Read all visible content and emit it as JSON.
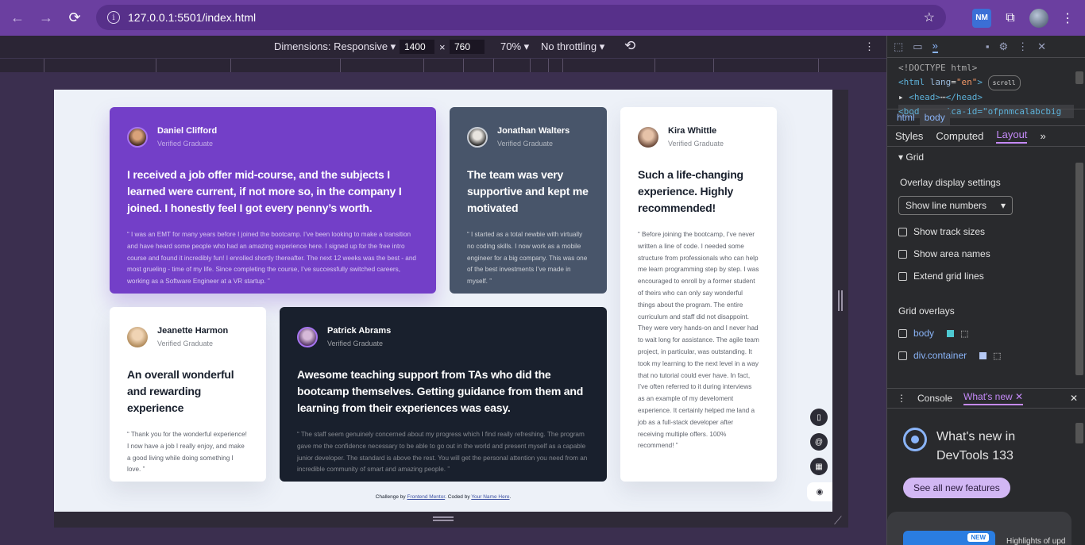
{
  "browser": {
    "url": "127.0.0.1:5501/index.html",
    "back_icon": "back-arrow-icon",
    "forward_icon": "forward-arrow-icon",
    "reload_icon": "reload-icon",
    "ext_label": "NM"
  },
  "device_toolbar": {
    "dimensions": "Dimensions: Responsive ▾",
    "width": "1400",
    "times": "×",
    "height": "760",
    "zoom": "70% ▾",
    "throttle": "No throttling ▾"
  },
  "testimonials": [
    {
      "name": "Daniel Clifford",
      "tag": "Verified Graduate",
      "headline": "I received a job offer mid-course, and the subjects I learned were current, if not more so, in the company I joined. I honestly feel I got every penny’s worth.",
      "quote": "“ I was an EMT for many years before I joined the bootcamp. I’ve been looking to make a transition and have heard some people who had an amazing experience here. I signed up for the free intro course and found it incredibly fun! I enrolled shortly thereafter. The next 12 weeks was the best - and most grueling - time of my life. Since completing the course, I’ve successfully switched careers, working as a Software Engineer at a VR startup. ”"
    },
    {
      "name": "Jonathan Walters",
      "tag": "Verified Graduate",
      "headline": "The team was very supportive and kept me motivated",
      "quote": "“ I started as a total newbie with virtually no coding skills. I now work as a mobile engineer for a big company. This was one of the best investments I’ve made in myself. ”"
    },
    {
      "name": "Kira Whittle",
      "tag": "Verified Graduate",
      "headline": "Such a life-changing experience. Highly recommended!",
      "quote": "“ Before joining the bootcamp, I’ve never written a line of code. I needed some structure from professionals who can help me learn programming step by step. I was encouraged to enroll by a former student of theirs who can only say wonderful things about the program. The entire curriculum and staff did not disappoint. They were very hands-on and I never had to wait long for assistance. The agile team project, in particular, was outstanding. It took my learning to the next level in a way that no tutorial could ever have. In fact, I’ve often referred to it during interviews as an example of my develoment experience. It certainly helped me land a job as a full-stack developer after receiving multiple offers. 100% recommend! ”"
    },
    {
      "name": "Jeanette Harmon",
      "tag": "Verified Graduate",
      "headline": "An overall wonderful and rewarding experience",
      "quote": "“ Thank you for the wonderful experience! I now have a job I really enjoy, and make a good living while doing something I love. ”"
    },
    {
      "name": "Patrick Abrams",
      "tag": "Verified Graduate",
      "headline": "Awesome teaching support from TAs who did the bootcamp themselves. Getting guidance from them and learning from their experiences was easy.",
      "quote": "“ The staff seem genuinely concerned about my progress which I find really refreshing. The program gave me the confidence necessary to be able to go out in the world and present myself as a capable junior developer. The standard is above the rest. You will get the personal attention you need from an incredible community of smart and amazing people. ”"
    }
  ],
  "attribution": {
    "prefix": "Challenge by ",
    "fm": "Frontend Mentor",
    "mid": ". Coded by ",
    "name": "Your Name Here",
    "end": "."
  },
  "devtools": {
    "dom_doctype": "<!DOCTYPE html>",
    "dom_html_tag": "<html",
    "dom_html_attr": "lang",
    "dom_html_val": "\"en\"",
    "dom_html_close": ">",
    "dom_scroll": "scroll",
    "dom_head": "<head>",
    "dom_head_close": "</head>",
    "dom_ellipsis": "⋯",
    "dom_body": "<body monica-id=\"ofpnmcalabcbig",
    "crumb_html": "html",
    "crumb_body": "body",
    "tab_styles": "Styles",
    "tab_computed": "Computed",
    "tab_layout": "Layout",
    "grid_title": "Grid",
    "overlay_heading": "Overlay display settings",
    "select_value": "Show line numbers",
    "check_track": "Show track sizes",
    "check_area": "Show area names",
    "check_extend": "Extend grid lines",
    "overlays_heading": "Grid overlays",
    "overlay_body": "body",
    "overlay_container": "div.container",
    "drawer_console": "Console",
    "drawer_whatsnew": "What's new",
    "wn_title_1": "What's new in",
    "wn_title_2": "DevTools 133",
    "wn_button": "See all new features",
    "wn_card_label": "NEW",
    "wn_card_text": "Highlights of upd"
  },
  "colors": {
    "purple": "#733fc8",
    "gray": "#48556a",
    "dark": "#19202d",
    "overlay_body": "#4ec9d2",
    "overlay_container": "#b5c8f4"
  }
}
